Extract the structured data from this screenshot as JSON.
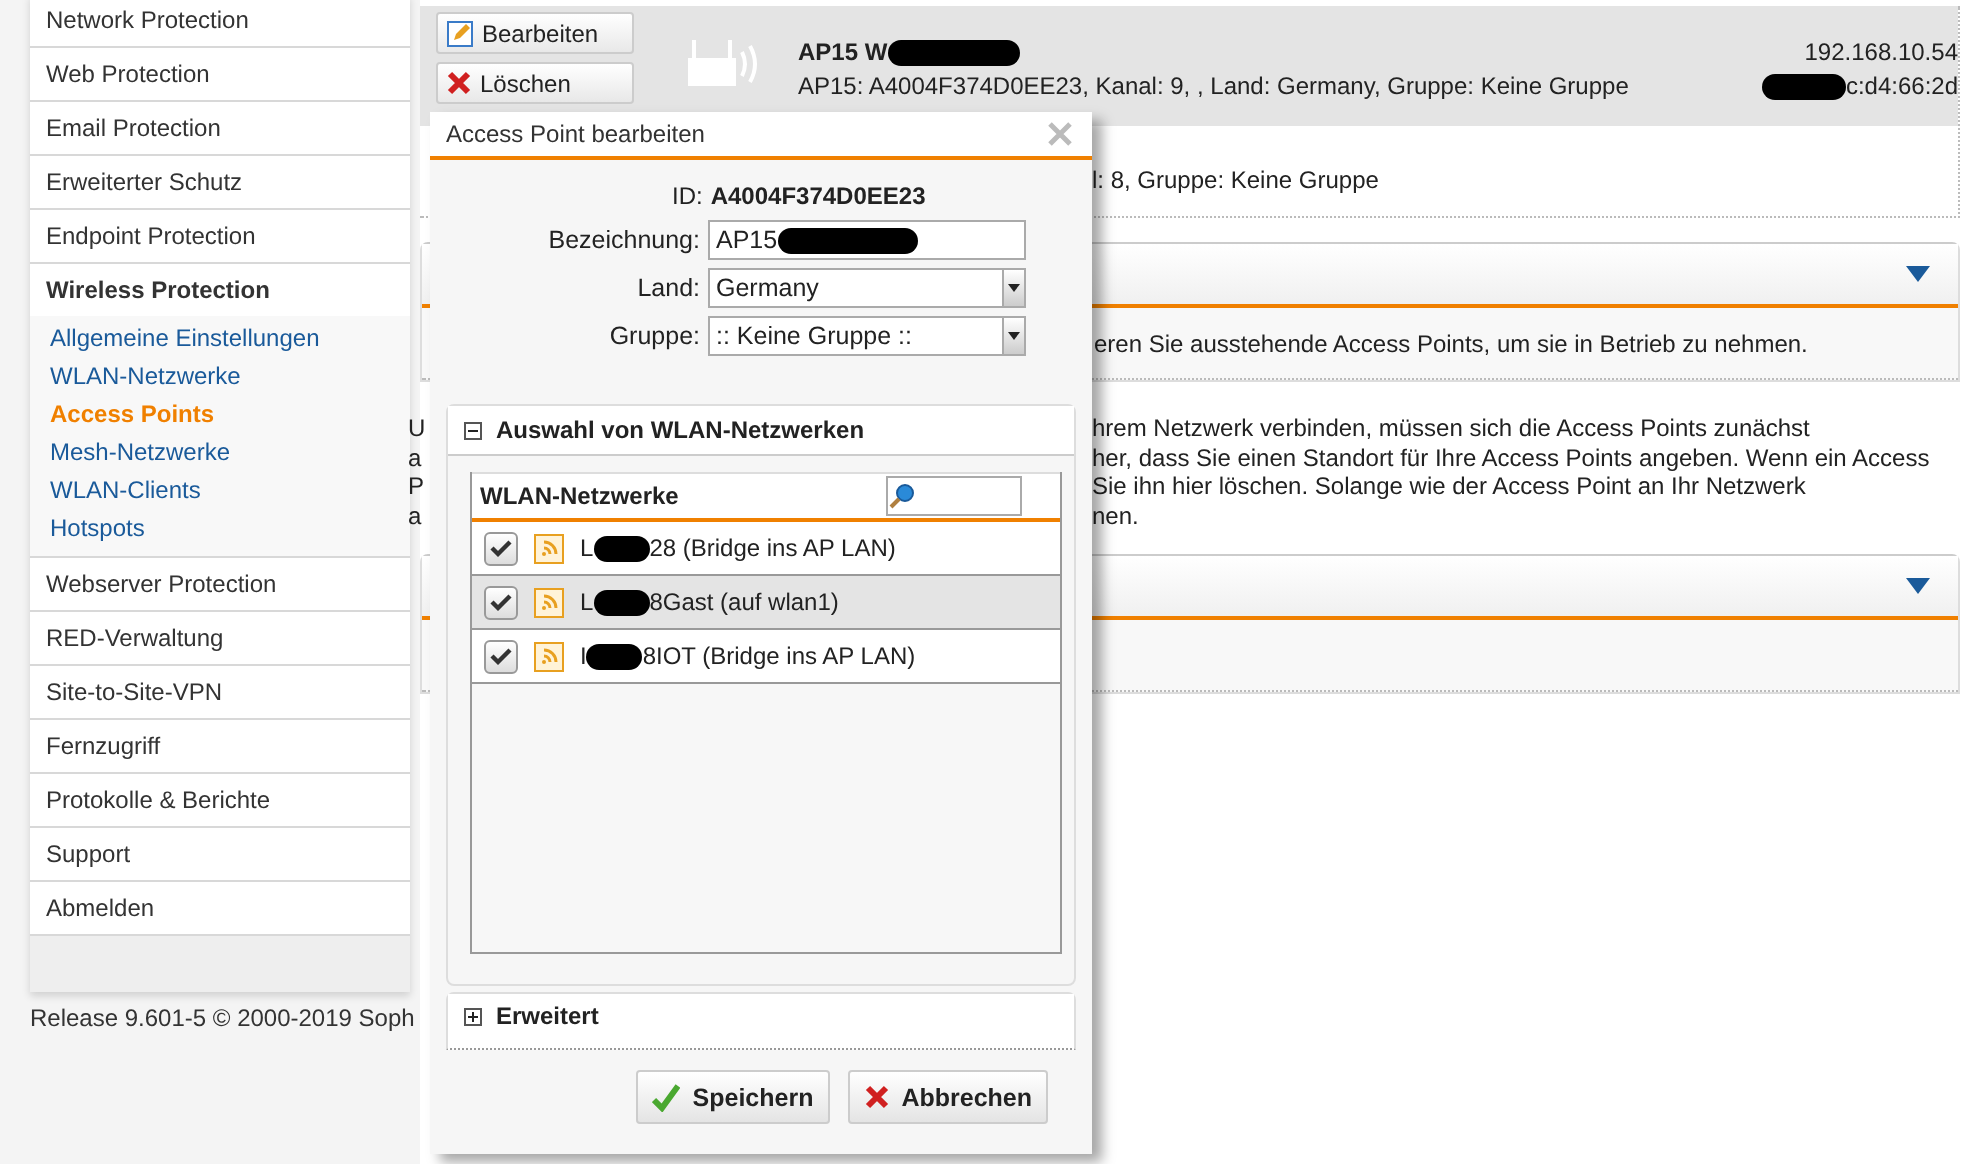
{
  "sidebar": {
    "items": [
      {
        "label": "Network Protection",
        "expanded": false
      },
      {
        "label": "Web Protection",
        "expanded": false
      },
      {
        "label": "Email Protection",
        "expanded": false
      },
      {
        "label": "Erweiterter Schutz",
        "expanded": false
      },
      {
        "label": "Endpoint Protection",
        "expanded": false
      },
      {
        "label": "Wireless Protection",
        "expanded": true,
        "children": [
          {
            "label": "Allgemeine Einstellungen",
            "selected": false
          },
          {
            "label": "WLAN-Netzwerke",
            "selected": false
          },
          {
            "label": "Access Points",
            "selected": true
          },
          {
            "label": "Mesh-Netzwerke",
            "selected": false
          },
          {
            "label": "WLAN-Clients",
            "selected": false
          },
          {
            "label": "Hotspots",
            "selected": false
          }
        ]
      },
      {
        "label": "Webserver Protection",
        "expanded": false
      },
      {
        "label": "RED-Verwaltung",
        "expanded": false
      },
      {
        "label": "Site-to-Site-VPN",
        "expanded": false
      },
      {
        "label": "Fernzugriff",
        "expanded": false
      },
      {
        "label": "Protokolle & Berichte",
        "expanded": false
      },
      {
        "label": "Support",
        "expanded": false
      },
      {
        "label": "Abmelden",
        "expanded": false
      }
    ]
  },
  "footer": "Release 9.601-5  © 2000-2019 Soph",
  "access_point": {
    "buttons": [
      "Bearbeiten",
      "Löschen"
    ],
    "name": "AP15 W",
    "details": "AP15: A4004F374D0EE23, Kanal: 9, , Land: Germany, Gruppe: Keine Gruppe",
    "ip": "192.168.10.54",
    "mac": "c:d4:66:2d",
    "second_row": "l: 8, Gruppe: Keine Gruppe"
  },
  "pending_panel": {
    "text": "eren Sie ausstehende Access Points, um sie in Betrieb zu nehmen."
  },
  "info_paragraph": {
    "left": [
      "U",
      "a",
      "P",
      "a"
    ],
    "right": [
      "hrem Netzwerk verbinden, müssen sich die Access Points zunächst",
      "her, dass Sie einen Standort für Ihre Access Points angeben. Wenn ein Access",
      "Sie ihn hier löschen. Solange wie der Access Point an Ihr Netzwerk",
      "nen."
    ]
  },
  "dialog": {
    "title": "Access Point bearbeiten",
    "id_label": "ID:",
    "id_value": "A4004F374D0EE23",
    "fields": [
      {
        "kind": "text",
        "label": "Bezeichnung:",
        "value": "AP15 "
      },
      {
        "kind": "select",
        "label": "Land:",
        "value": "Germany"
      },
      {
        "kind": "select",
        "label": "Gruppe:",
        "value": ":: Keine Gruppe ::"
      }
    ],
    "wlan_section": {
      "title": "Auswahl von WLAN-Netzwerken",
      "expanded": true,
      "column": "WLAN-Netzwerke",
      "networks": [
        {
          "prefix": "L",
          "suffix": "28 (Bridge ins AP LAN)",
          "checked": true,
          "selected": false
        },
        {
          "prefix": "L",
          "suffix": "8Gast (auf wlan1)",
          "checked": true,
          "selected": true
        },
        {
          "prefix": "I",
          "suffix": "8IOT (Bridge ins AP LAN)",
          "checked": true,
          "selected": false
        }
      ]
    },
    "advanced_section": {
      "title": "Erweitert",
      "expanded": false
    },
    "buttons": [
      {
        "kind": "save",
        "label": "Speichern"
      },
      {
        "kind": "cancel",
        "label": "Abbrechen"
      }
    ]
  }
}
